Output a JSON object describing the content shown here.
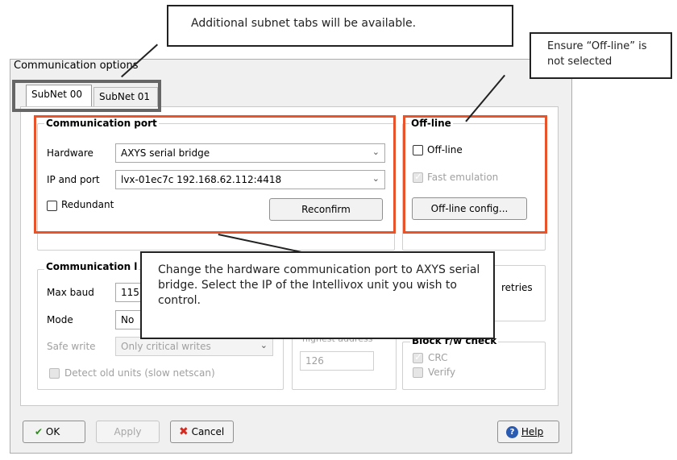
{
  "window": {
    "title": "Communication options"
  },
  "tabs": [
    {
      "label": "SubNet 00",
      "active": true
    },
    {
      "label": "SubNet 01",
      "active": false
    }
  ],
  "comm_port": {
    "title": "Communication port",
    "hardware_label": "Hardware",
    "hardware_value": "AXYS serial bridge",
    "ip_label": "IP and port",
    "ip_value": "lvx-01ec7c 192.168.62.112:4418",
    "redundant_label": "Redundant",
    "reconfirm_label": "Reconfirm"
  },
  "offline": {
    "title": "Off-line",
    "offline_label": "Off-line",
    "fast_emulation_label": "Fast emulation",
    "config_button": "Off-line config..."
  },
  "comm_link": {
    "title_partial": "Communication l",
    "max_baud_label": "Max baud",
    "max_baud_value": "115",
    "mode_label": "Mode",
    "mode_value": "No",
    "safe_write_label": "Safe write",
    "safe_write_value": "Only critical writes",
    "detect_label": "Detect old units (slow netscan)"
  },
  "address": {
    "partial_label": "highest address",
    "value": "126"
  },
  "retries": {
    "partial_label": "retries"
  },
  "block_check": {
    "title": "Block r/w check",
    "crc_label": "CRC",
    "verify_label": "Verify"
  },
  "footer": {
    "ok": "OK",
    "apply": "Apply",
    "cancel": "Cancel",
    "help": "Help"
  },
  "annotations": {
    "tabs_note": "Additional subnet tabs will be available.",
    "offline_note": "Ensure “Off-line” is not selected",
    "port_note": "Change the hardware communication port to AXYS serial bridge. Select the IP of the Intellivox unit you wish to control."
  },
  "colors": {
    "highlight": "#e8532a",
    "ok_green": "#2e8b1e",
    "cancel_red": "#d42a1f",
    "help_blue": "#2a5bb3"
  }
}
